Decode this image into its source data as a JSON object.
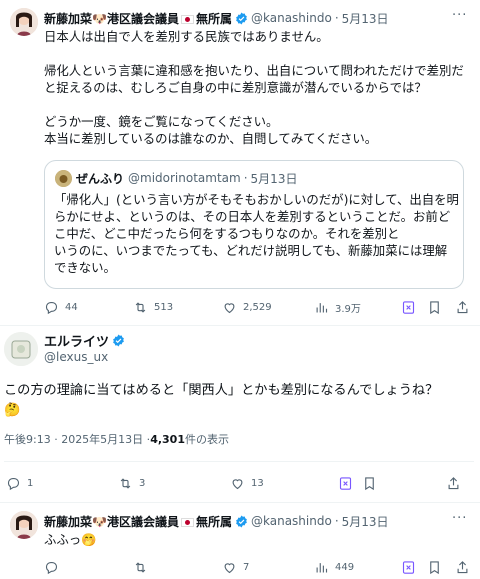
{
  "post1": {
    "author_name_a": "新藤加菜",
    "author_name_b": "港区議会議員",
    "author_name_c": "無所属",
    "dog_emoji": "🐶",
    "handle": "@kanashindo",
    "date": "5月13日",
    "more": "···",
    "lines": [
      "日本人は出自で人を差別する民族ではありません。",
      "",
      "帰化人という言葉に違和感を抱いたり、出自について問われただけで差別だ",
      "と捉えるのは、むしろご自身の中に差別意識が潜んでいるからでは？",
      "",
      "どうか一度、鏡をご覧になってください。",
      "本当に差別しているのは誰なのか、自問してみてください。"
    ],
    "quote": {
      "author_name": "ぜんふり",
      "handle": "@midorinotamtam",
      "date": "5月13日",
      "lines": [
        "「帰化人」(という言い方がそもそもおかしいのだが)に対して、出自を明",
        "らかにせよ、というのは、その日本人を差別するということだ。お前ど",
        "こ中だ、どこ中だったら何をするつもりなのか。それを差別と",
        "いうのに、いつまでたっても、どれだけ説明しても、新藤加菜には理解",
        "できない。"
      ]
    },
    "stats": {
      "replies": "44",
      "reposts": "513",
      "likes": "2,529",
      "views": "3.9万"
    }
  },
  "post2": {
    "author_name": "エルライツ",
    "handle": "@lexus_ux",
    "text_line1": "この方の理論に当てはめると「関西人」とかも差別になるんでしょうね？",
    "emoji": "🤔",
    "time": "午後9:13 · 2025年5月13日 · ",
    "views_count": "4,301",
    "views_suffix": " 件の表示",
    "stats": {
      "replies": "1",
      "reposts": "3",
      "likes": "13"
    }
  },
  "post3": {
    "author_name_a": "新藤加菜",
    "author_name_b": "港区議会議員",
    "author_name_c": "無所属",
    "dog_emoji": "🐶",
    "handle": "@kanashindo",
    "date": "5月13日",
    "more": "···",
    "text": "ふふっ",
    "emoji": "🤭",
    "stats": {
      "likes": "7",
      "views": "449"
    }
  },
  "colors": {
    "verified": "#1d9bf0",
    "muted": "#536471",
    "bookmark": "#7856ff"
  }
}
